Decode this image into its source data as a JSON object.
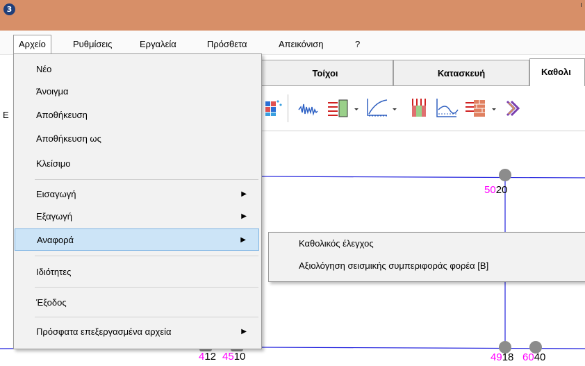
{
  "app": {
    "icon_glyph": "3"
  },
  "menubar": {
    "items": [
      "Αρχείο",
      "Ρυθμίσεις",
      "Εργαλεία",
      "Πρόσθετα",
      "Απεικόνιση",
      "?"
    ]
  },
  "tabs": [
    "Τοίχοι",
    "Κατασκευή",
    "Καθολι"
  ],
  "left_edge_letter": "Ε",
  "file_menu": {
    "items": [
      {
        "label": "Νέο"
      },
      {
        "label": "Άνοιγμα"
      },
      {
        "label": "Αποθήκευση"
      },
      {
        "label": "Αποθήκευση ως"
      },
      {
        "label": "Κλείσιμο"
      },
      {
        "label": "Εισαγωγή",
        "submenu": true
      },
      {
        "label": "Εξαγωγή",
        "submenu": true
      },
      {
        "label": "Αναφορά",
        "submenu": true,
        "highlighted": true
      },
      {
        "label": "Ιδιότητες"
      },
      {
        "label": "Έξοδος"
      },
      {
        "label": "Πρόσφατα επεξεργασμένα αρχεία",
        "submenu": true
      }
    ]
  },
  "report_submenu": {
    "items": [
      "Καθολικός έλεγχος",
      "Αξιολόγηση σεισμικής συμπεριφοράς φορέα [Β]"
    ]
  },
  "canvas": {
    "node_labels": [
      {
        "magenta": "50",
        "black": "20"
      },
      {
        "magenta": "4",
        "black": "12"
      },
      {
        "magenta": "45",
        "black": "10"
      },
      {
        "magenta": "49",
        "black": "18"
      },
      {
        "magenta": "60",
        "black": "40"
      }
    ]
  },
  "colors": {
    "titlebar": "#d78f68",
    "highlight": "#cce4f7",
    "node_magenta": "#ff00ff",
    "line_blue": "#2222dd"
  }
}
